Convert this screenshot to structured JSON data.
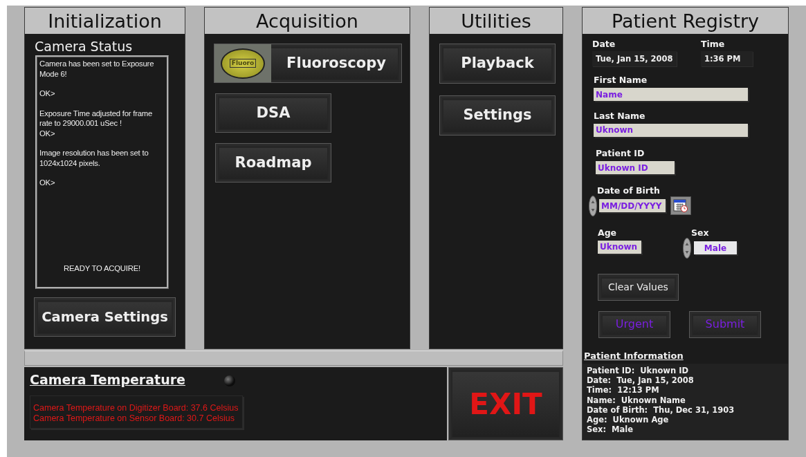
{
  "initialization": {
    "title": "Initialization",
    "status_label": "Camera Status",
    "log": [
      {
        "lines": [
          "Camera has been set to Exposure Mode 6!"
        ]
      },
      {
        "lines": [
          "OK>"
        ]
      },
      {
        "lines": [
          "Exposure Time adjusted for frame rate to 29000.001 uSec !",
          "OK>"
        ]
      },
      {
        "lines": [
          "Image resolution has been set to 1024x1024 pixels."
        ]
      },
      {
        "lines": [
          "OK>"
        ]
      }
    ],
    "ready_message": "READY TO ACQUIRE!",
    "button": "Camera Settings"
  },
  "acquisition": {
    "title": "Acquisition",
    "buttons": [
      {
        "label": "Fluoroscopy",
        "kind": "picture",
        "icon_label": "Fluoro"
      },
      {
        "label": "DSA",
        "kind": "plain"
      },
      {
        "label": "Roadmap",
        "kind": "plain"
      }
    ]
  },
  "utilities": {
    "title": "Utilities",
    "buttons": [
      "Playback",
      "Settings"
    ]
  },
  "temperature": {
    "title": "Camera Temperature",
    "led_on": false,
    "readings": [
      "Camera Temperature on Digitizer Board: 37.6 Celsius",
      "Camera Temperature on Sensor Board: 30.7 Celsius"
    ]
  },
  "exit_button": "EXIT",
  "registry": {
    "title": "Patient Registry",
    "date": {
      "label": "Date",
      "value": "Tue, Jan 15, 2008"
    },
    "time": {
      "label": "Time",
      "value": "1:36 PM"
    },
    "first_name": {
      "label": "First Name",
      "value": "Name"
    },
    "last_name": {
      "label": "Last Name",
      "value": "Uknown"
    },
    "patient_id": {
      "label": "Patient ID",
      "value": "Uknown ID"
    },
    "date_of_birth": {
      "label": "Date of Birth",
      "value": "MM/DD/YYYY"
    },
    "age": {
      "label": "Age",
      "value": "Uknown"
    },
    "sex": {
      "label": "Sex",
      "value": "Male"
    },
    "buttons": [
      {
        "label": "Clear Values",
        "kind": "neutral"
      },
      {
        "label": "Urgent",
        "kind": "accent"
      },
      {
        "label": "Submit",
        "kind": "accent"
      }
    ],
    "info": {
      "title": "Patient Information",
      "lines": [
        "Patient ID:  Uknown ID",
        "Date:  Tue, Jan 15, 2008",
        "Time:  12:13 PM",
        "Name:  Uknown Name",
        "Date of Birth:  Thu, Dec 31, 1903",
        "Age:  Uknown Age",
        "Sex:  Male"
      ]
    }
  }
}
